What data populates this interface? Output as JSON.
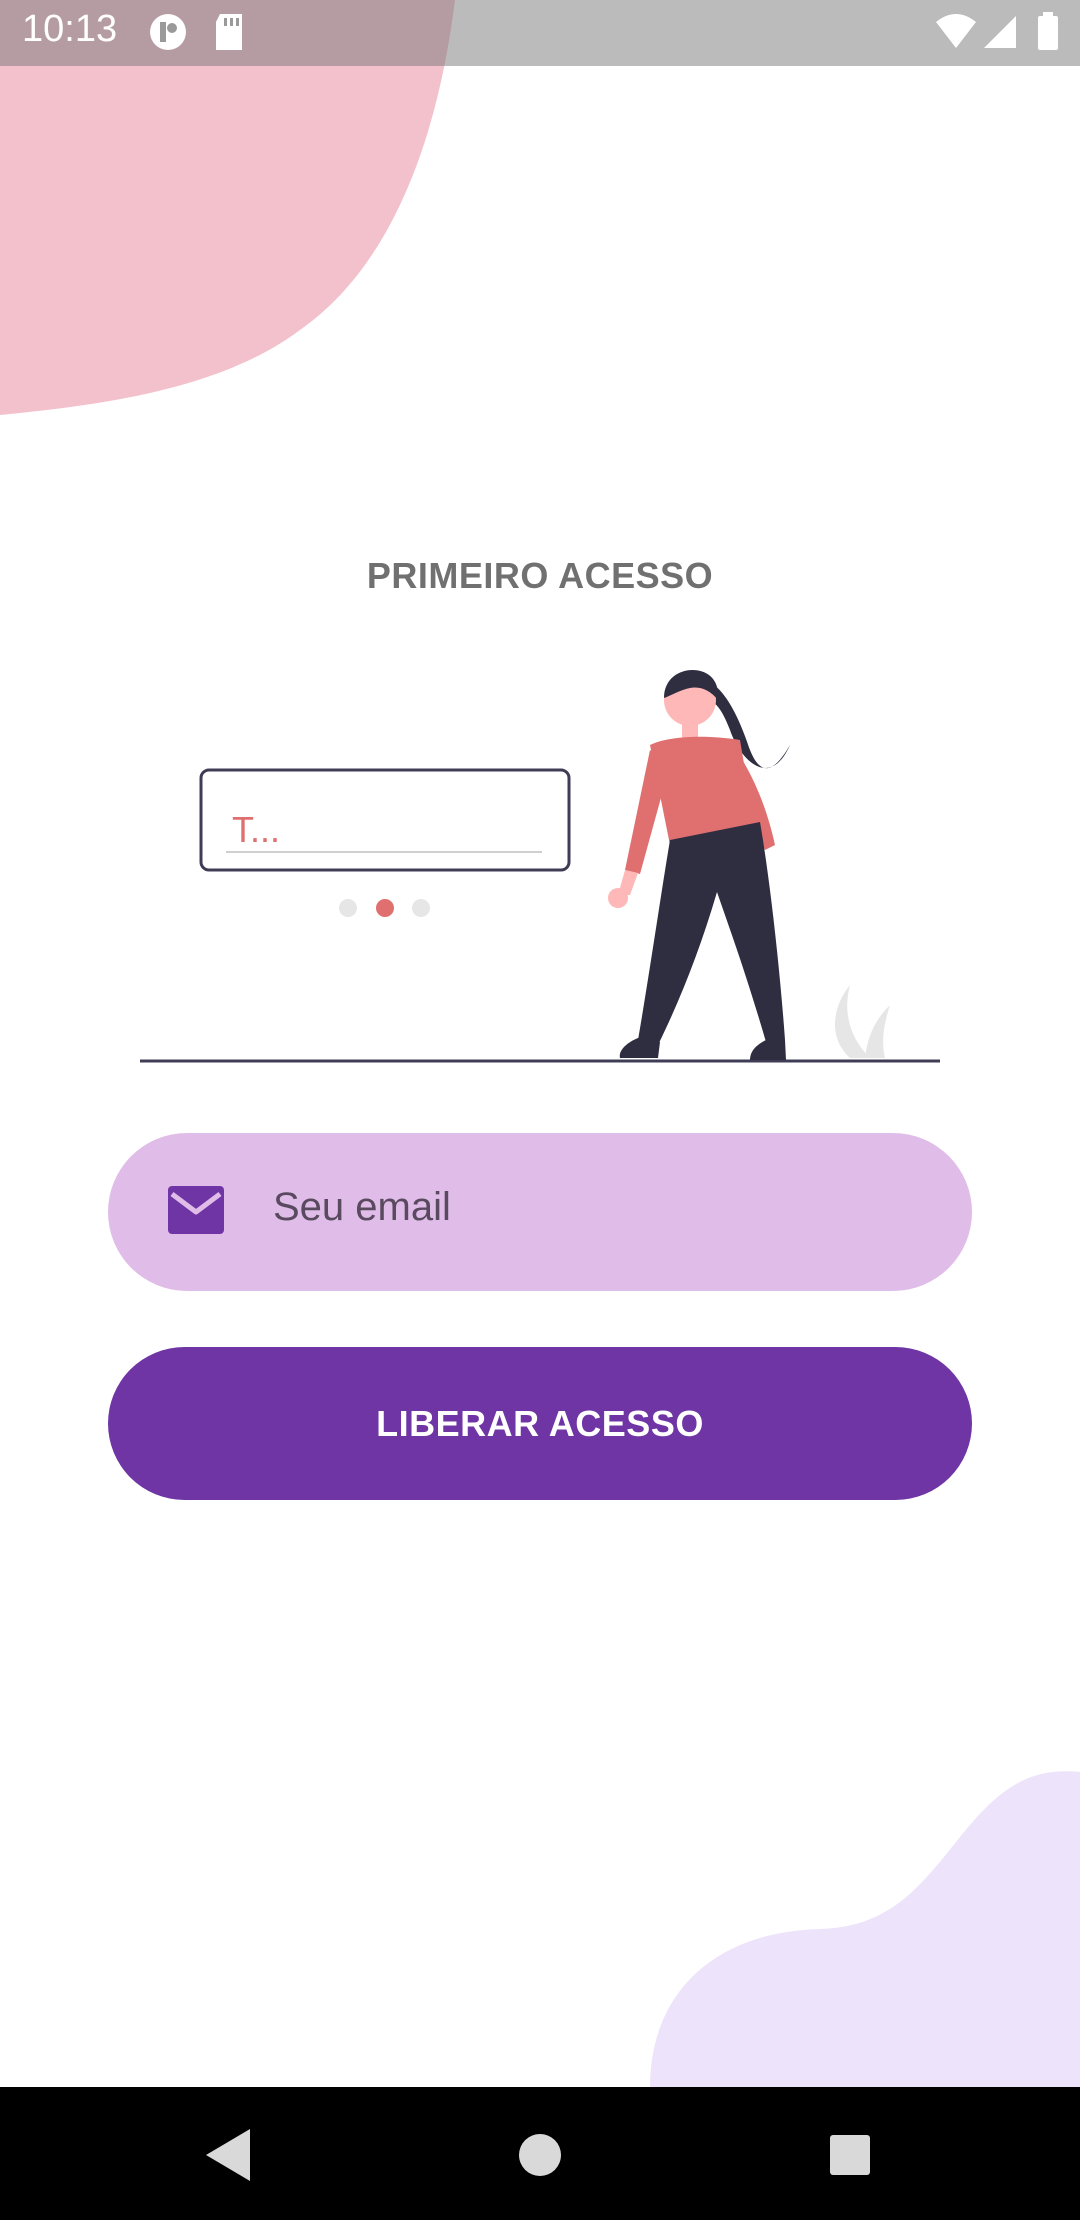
{
  "status_bar": {
    "time": "10:13",
    "icons": [
      "app-notification-icon",
      "sd-card-icon",
      "wifi-icon",
      "signal-icon",
      "battery-icon"
    ]
  },
  "colors": {
    "accent": "#6f35a5",
    "field_bg": "#e0bde8",
    "blob_pink": "#f3c1cc",
    "blob_lavender": "#ede3fb",
    "illustration_red": "#e07070",
    "illustration_dark": "#2f2e41"
  },
  "screen": {
    "title": "PRIMEIRO ACESSO",
    "illustration_text": "T...",
    "email_placeholder": "Seu email",
    "email_icon": "envelope-icon",
    "submit_label": "LIBERAR ACESSO"
  },
  "nav_bar": {
    "buttons": [
      "back-icon",
      "home-icon",
      "recents-icon"
    ]
  }
}
